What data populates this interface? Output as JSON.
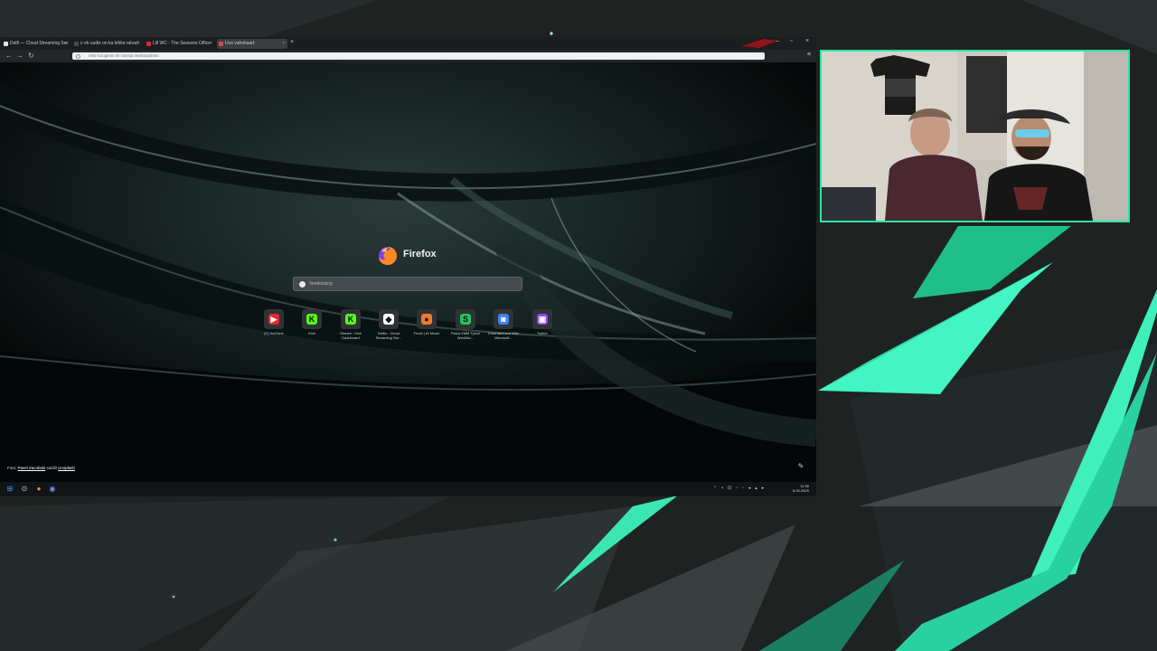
{
  "tabs": [
    {
      "label": "Delfi — Cloud Streaming Ser",
      "color": "#e8e8e8"
    },
    {
      "label": "v oh uudis on ka kõike rahad",
      "color": "#4a4a4a"
    },
    {
      "label": "Lill WC - The Seasons Office",
      "color": "#e0262c"
    },
    {
      "label": "Uus vahekaart",
      "color": "#d94a3a"
    }
  ],
  "urlbar": {
    "text": "Otsi Googlest või sisesta veebiaadress"
  },
  "brand": {
    "name": "Firefox"
  },
  "search": {
    "placeholder": "Veebiotsing"
  },
  "shortcuts": [
    {
      "label": "(1) YouTube",
      "glyph": "▶",
      "color": "#e8262b"
    },
    {
      "label": "Kick",
      "glyph": "K",
      "color": "#53fc18"
    },
    {
      "label": "Stream - Kick Dashboard",
      "glyph": "K",
      "color": "#53fc18"
    },
    {
      "label": "Delfio - Cloud Streaming Ser...",
      "glyph": "◆",
      "color": "#ffffff"
    },
    {
      "label": "Fresh | AI Movie",
      "glyph": "●",
      "color": "#f07a2a"
    },
    {
      "label": "Plaza VMM Tyson Wed/Mo...",
      "glyph": "S",
      "color": "#22c55e"
    },
    {
      "label": "Entertainment Wiki Microsoft...",
      "glyph": "◙",
      "color": "#3b82f6"
    },
    {
      "label": "Twitch",
      "glyph": "▣",
      "color": "#9146ff"
    }
  ],
  "credit": {
    "prefix": "Foto:",
    "author": "Pavel Zacobski",
    "middle": "saidilt",
    "site": "Unsplash"
  },
  "taskbar": {
    "icons": [
      "windows-start",
      "search",
      "firefox",
      "discord"
    ],
    "clock": {
      "time": "11:38",
      "date": "6.03.2025"
    }
  },
  "colors": {
    "accent": "#2fe3a8",
    "browser_bg": "#0b0f0f",
    "page_bg": "#1c2120"
  }
}
